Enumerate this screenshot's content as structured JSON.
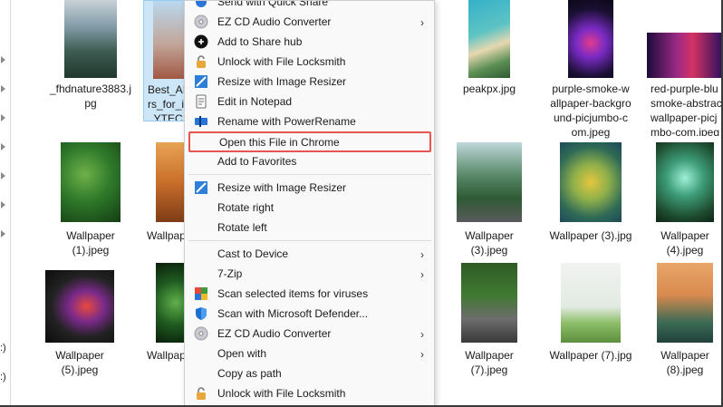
{
  "files": [
    {
      "label": "_fhdnature3883.j\npg",
      "selected": false
    },
    {
      "label": "Best_AI_\nrs_for_i\n_YTEC",
      "selected": true
    },
    {
      "label": "peakpx.jpg",
      "selected": false
    },
    {
      "label": "purple-smoke-w\nallpaper-backgro\nund-picjumbo-c\nom.jpeg",
      "selected": false
    },
    {
      "label": "red-purple-blu\nsmoke-abstrac\nwallpaper-picj\nmbo-com.jpeg",
      "selected": false
    },
    {
      "label": "Wallpaper\n(1).jpeg",
      "selected": false
    },
    {
      "label": "Wallpap",
      "selected": false
    },
    {
      "label": "Wallpaper\n(3).jpeg",
      "selected": false
    },
    {
      "label": "Wallpaper (3).jpg",
      "selected": false
    },
    {
      "label": "Wallpaper\n(4).jpeg",
      "selected": false
    },
    {
      "label": "Wallpaper\n(5).jpeg",
      "selected": false
    },
    {
      "label": "Wallpap",
      "selected": false
    },
    {
      "label": "Wallpaper\n(7).jpeg",
      "selected": false
    },
    {
      "label": "Wallpaper (7).jpg",
      "selected": false
    },
    {
      "label": "Wallpaper\n(8).jpeg",
      "selected": false
    }
  ],
  "nav": {
    "drive_label_1": ":)",
    "drive_label_2": ":)"
  },
  "menu": {
    "items": [
      {
        "label": "Send with Quick Share",
        "icon": "quick-share-icon",
        "submenu": false
      },
      {
        "label": "EZ CD Audio Converter",
        "icon": "cd-icon",
        "submenu": true
      },
      {
        "label": "Add to Share hub",
        "icon": "share-hub-icon",
        "submenu": false
      },
      {
        "label": "Unlock with File Locksmith",
        "icon": "lock-icon",
        "submenu": false
      },
      {
        "label": "Resize with Image Resizer",
        "icon": "image-resizer-icon",
        "submenu": false
      },
      {
        "label": "Edit in Notepad",
        "icon": "notepad-icon",
        "submenu": false
      },
      {
        "label": "Rename with PowerRename",
        "icon": "power-rename-icon",
        "submenu": false
      },
      {
        "label": "Open this File in Chrome",
        "icon": "",
        "submenu": false,
        "highlighted": true
      },
      {
        "label": "Add to Favorites",
        "icon": "",
        "submenu": false
      },
      {
        "label": "Resize with Image Resizer",
        "icon": "image-resizer-icon",
        "submenu": false
      },
      {
        "label": "Rotate right",
        "icon": "",
        "submenu": false
      },
      {
        "label": "Rotate left",
        "icon": "",
        "submenu": false
      },
      {
        "label": "Cast to Device",
        "icon": "",
        "submenu": true
      },
      {
        "label": "7-Zip",
        "icon": "",
        "submenu": true
      },
      {
        "label": "Scan selected items for viruses",
        "icon": "antivirus-icon",
        "submenu": false
      },
      {
        "label": "Scan with Microsoft Defender...",
        "icon": "defender-shield-icon",
        "submenu": false
      },
      {
        "label": "EZ CD Audio Converter",
        "icon": "cd-icon",
        "submenu": true
      },
      {
        "label": "Open with",
        "icon": "",
        "submenu": true
      },
      {
        "label": "Copy as path",
        "icon": "",
        "submenu": false
      },
      {
        "label": "Unlock with File Locksmith",
        "icon": "lock-icon",
        "submenu": false
      }
    ],
    "chevron": "›"
  },
  "colors": {
    "selection": "#cde6f7",
    "highlight_border": "#e8554e",
    "menu_bg": "#f9f9f9"
  }
}
